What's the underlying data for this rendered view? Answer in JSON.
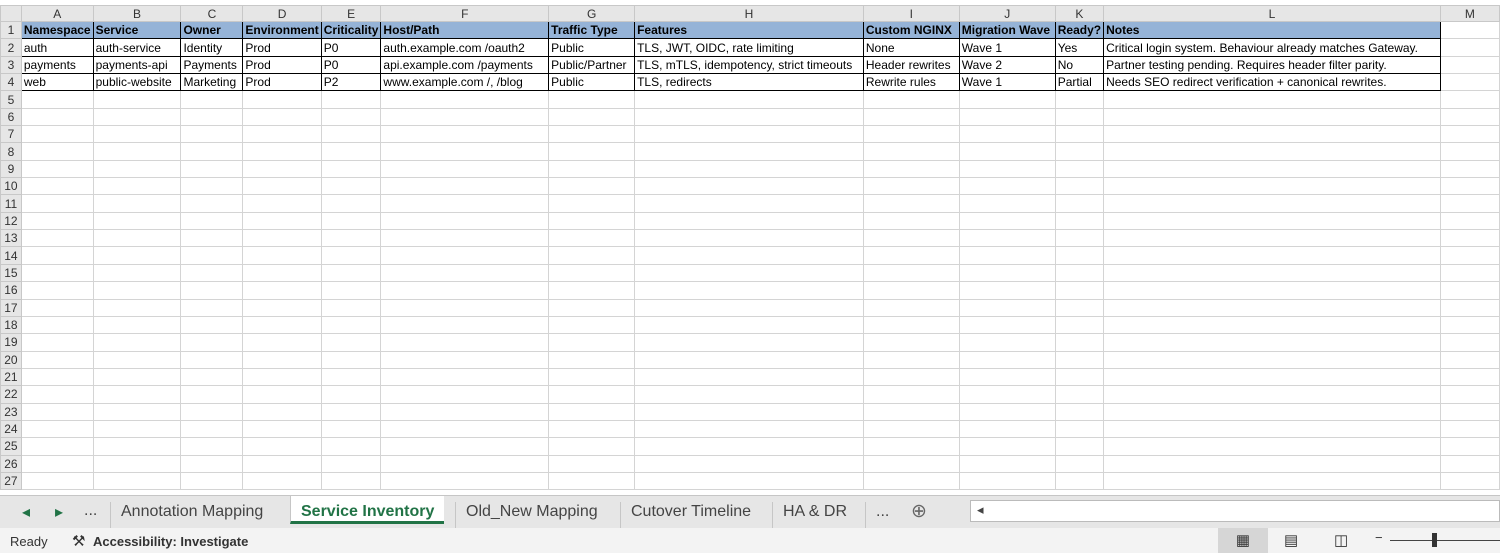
{
  "columns": [
    "A",
    "B",
    "C",
    "D",
    "E",
    "F",
    "G",
    "H",
    "I",
    "J",
    "K",
    "L",
    "M"
  ],
  "headers": [
    "Namespace",
    "Service",
    "Owner",
    "Environment",
    "Criticality",
    "Host/Path",
    "Traffic Type",
    "Features",
    "Custom NGINX",
    "Migration Wave",
    "Ready?",
    "Notes"
  ],
  "rows": [
    [
      "auth",
      "auth-service",
      "Identity",
      "Prod",
      "P0",
      "auth.example.com /oauth2",
      "Public",
      "TLS, JWT, OIDC, rate limiting",
      "None",
      "Wave 1",
      "Yes",
      "Critical login system. Behaviour already matches Gateway."
    ],
    [
      "payments",
      "payments-api",
      "Payments",
      "Prod",
      "P0",
      "api.example.com /payments",
      "Public/Partner",
      "TLS, mTLS, idempotency, strict timeouts",
      "Header rewrites",
      "Wave 2",
      "No",
      "Partner testing pending. Requires header filter parity."
    ],
    [
      "web",
      "public-website",
      "Marketing",
      "Prod",
      "P2",
      "www.example.com /, /blog",
      "Public",
      "TLS, redirects",
      "Rewrite rules",
      "Wave 1",
      "Partial",
      "Needs SEO redirect verification + canonical rewrites."
    ]
  ],
  "row_count": 27,
  "sheet_tabs": [
    "Annotation Mapping",
    "Service Inventory",
    "Old_New Mapping",
    "Cutover Timeline",
    "HA & DR"
  ],
  "active_tab": "Service Inventory",
  "more_label": "...",
  "status": {
    "ready": "Ready",
    "accessibility": "Accessibility: Investigate"
  }
}
